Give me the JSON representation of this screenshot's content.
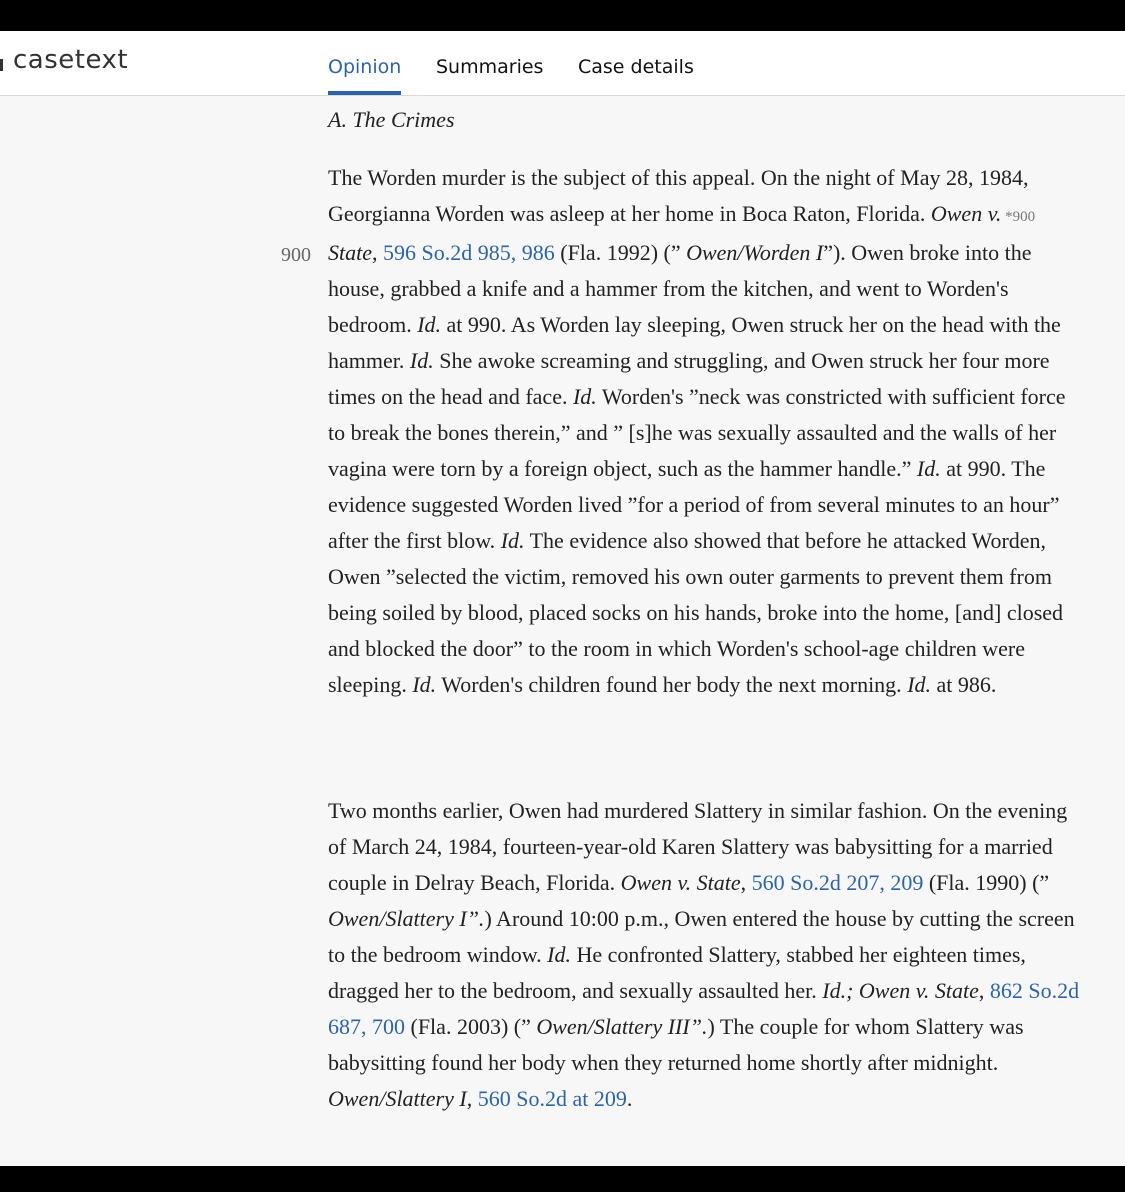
{
  "header": {
    "logo_text": "casetext",
    "tabs": [
      {
        "label": "Opinion",
        "active": true
      },
      {
        "label": "Summaries",
        "active": false
      },
      {
        "label": "Case details",
        "active": false
      }
    ]
  },
  "opinion": {
    "section_heading": "A. The Crimes",
    "page_marker": "900",
    "para1": {
      "s1": "The Worden murder is the subject of this appeal. On the night of May 28, 1984, Georgianna Worden was asleep at her home in Boca Raton, Florida. ",
      "case1": "Owen v.",
      "star": " *900 ",
      "case1b": "State",
      "s2": ", ",
      "cite1": "596 So.2d 985, 986",
      "s3": " (Fla. 1992) (” ",
      "short1": "Owen/Worden I",
      "s4": "”). Owen broke into the house, grabbed a knife and a hammer from the kitchen, and went to Worden's bedroom. ",
      "id1": "Id.",
      "s5": " at 990. As Worden lay sleeping, Owen struck her on the head with the hammer. ",
      "id2": "Id.",
      "s6": " She awoke screaming and struggling, and Owen struck her four more times on the head and face. ",
      "id3": "Id.",
      "s7": " Worden's ”neck was constricted with sufficient force to break the bones therein,” and ” [s]he was sexually assaulted and the walls of her vagina were torn by a foreign object, such as the hammer handle.” ",
      "id4": "Id.",
      "s8": " at 990. The evidence suggested Worden lived ”for a period of from several minutes to an hour” after the first blow. ",
      "id5": "Id.",
      "s9": " The evidence also showed that before he attacked Worden, Owen ”selected the victim, removed his own outer garments to prevent them from being soiled by blood, placed socks on his hands, broke into the home, [and] closed and blocked the door” to the room in which Worden's school-age children were sleeping. ",
      "id6": "Id.",
      "s10": " Worden's children found her body the next morning. ",
      "id7": "Id.",
      "s11": " at 986."
    },
    "para2": {
      "s1": "Two months earlier, Owen had murdered Slattery in similar fashion. On the evening of March 24, 1984, fourteen-year-old Karen Slattery was babysitting for a married couple in Delray Beach, Florida. ",
      "case1": "Owen v. State",
      "s2": ", ",
      "cite1": "560 So.2d 207, 209",
      "s3": " (Fla. 1990) (” ",
      "short1": "Owen/Slattery I”.",
      "s4": ") Around 10:00 p.m., Owen entered the house by cutting the screen to the bedroom window. ",
      "id1": "Id.",
      "s5": " He confronted Slattery, stabbed her eighteen times, dragged her to the bedroom, and sexually assaulted her. ",
      "id2": "Id.; Owen v. State",
      "s6": ", ",
      "cite2": "862 So.2d 687, 700",
      "s7": " (Fla. 2003) (” ",
      "short2": "Owen/Slattery III”.",
      "s8": ") The couple for whom Slattery was babysitting found her body when they returned home shortly after midnight. ",
      "short3": "Owen/Slattery I",
      "s9": ", ",
      "cite3": "560 So.2d at 209",
      "s10": "."
    }
  }
}
